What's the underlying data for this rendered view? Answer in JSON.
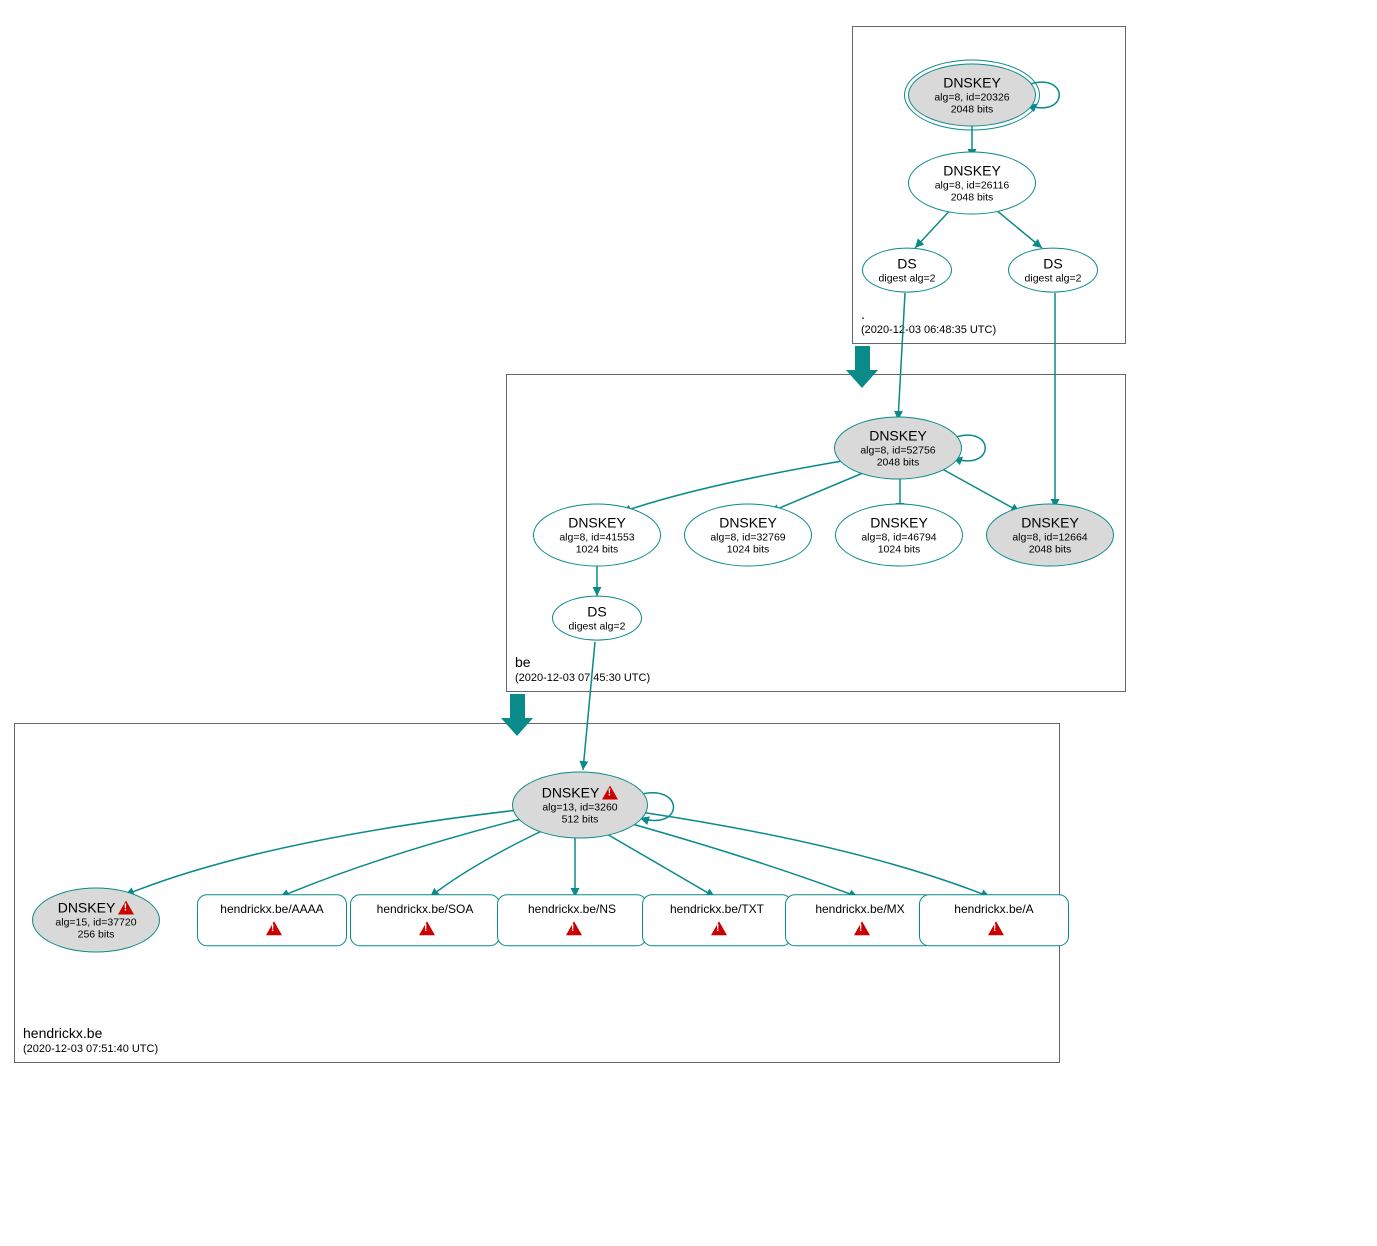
{
  "colors": {
    "accent": "#0a8a8a",
    "grey": "#d9d9d9",
    "warn": "#c00"
  },
  "zones": {
    "root": {
      "name": ".",
      "timestamp": "(2020-12-03 06:48:35 UTC)"
    },
    "be": {
      "name": "be",
      "timestamp": "(2020-12-03 07:45:30 UTC)"
    },
    "leaf": {
      "name": "hendrickx.be",
      "timestamp": "(2020-12-03 07:51:40 UTC)"
    }
  },
  "nodes": {
    "root_ksk": {
      "title": "DNSKEY",
      "l1": "alg=8, id=20326",
      "l2": "2048 bits"
    },
    "root_zsk": {
      "title": "DNSKEY",
      "l1": "alg=8, id=26116",
      "l2": "2048 bits"
    },
    "root_ds1": {
      "title": "DS",
      "l1": "digest alg=2"
    },
    "root_ds2": {
      "title": "DS",
      "l1": "digest alg=2"
    },
    "be_ksk": {
      "title": "DNSKEY",
      "l1": "alg=8, id=52756",
      "l2": "2048 bits"
    },
    "be_zsk1": {
      "title": "DNSKEY",
      "l1": "alg=8, id=41553",
      "l2": "1024 bits"
    },
    "be_zsk2": {
      "title": "DNSKEY",
      "l1": "alg=8, id=32769",
      "l2": "1024 bits"
    },
    "be_zsk3": {
      "title": "DNSKEY",
      "l1": "alg=8, id=46794",
      "l2": "1024 bits"
    },
    "be_key4": {
      "title": "DNSKEY",
      "l1": "alg=8, id=12664",
      "l2": "2048 bits"
    },
    "be_ds": {
      "title": "DS",
      "l1": "digest alg=2"
    },
    "leaf_ksk": {
      "title": "DNSKEY",
      "l1": "alg=13, id=3260",
      "l2": "512 bits",
      "warn": true
    },
    "leaf_key2": {
      "title": "DNSKEY",
      "l1": "alg=15, id=37720",
      "l2": "256 bits",
      "warn": true
    },
    "rr_aaaa": {
      "label": "hendrickx.be/AAAA"
    },
    "rr_soa": {
      "label": "hendrickx.be/SOA"
    },
    "rr_ns": {
      "label": "hendrickx.be/NS"
    },
    "rr_txt": {
      "label": "hendrickx.be/TXT"
    },
    "rr_mx": {
      "label": "hendrickx.be/MX"
    },
    "rr_a": {
      "label": "hendrickx.be/A"
    }
  }
}
